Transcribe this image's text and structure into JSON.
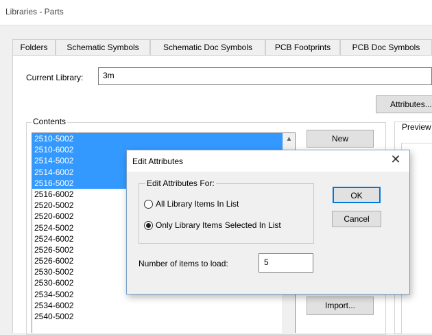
{
  "window": {
    "title": "Libraries - Parts"
  },
  "tabs": [
    {
      "label": "Folders",
      "active": false
    },
    {
      "label": "Schematic Symbols",
      "active": false
    },
    {
      "label": "Schematic Doc Symbols",
      "active": false
    },
    {
      "label": "PCB Footprints",
      "active": false
    },
    {
      "label": "PCB Doc Symbols",
      "active": false
    }
  ],
  "current_library": {
    "label": "Current Library:",
    "value": "3m"
  },
  "buttons": {
    "attributes": "Attributes...",
    "new": "New",
    "import": "Import..."
  },
  "contents": {
    "label": "Contents",
    "items": [
      {
        "text": "2510-5002",
        "selected": true
      },
      {
        "text": "2510-6002",
        "selected": true
      },
      {
        "text": "2514-5002",
        "selected": true
      },
      {
        "text": "2514-6002",
        "selected": true
      },
      {
        "text": "2516-5002",
        "selected": true
      },
      {
        "text": "2516-6002",
        "selected": false
      },
      {
        "text": "2520-5002",
        "selected": false
      },
      {
        "text": "2520-6002",
        "selected": false
      },
      {
        "text": "2524-5002",
        "selected": false
      },
      {
        "text": "2524-6002",
        "selected": false
      },
      {
        "text": "2526-5002",
        "selected": false
      },
      {
        "text": "2526-6002",
        "selected": false
      },
      {
        "text": "2530-5002",
        "selected": false
      },
      {
        "text": "2530-6002",
        "selected": false
      },
      {
        "text": "2534-5002",
        "selected": false
      },
      {
        "text": "2534-6002",
        "selected": false
      },
      {
        "text": "2540-5002",
        "selected": false
      }
    ]
  },
  "preview": {
    "label": "Preview"
  },
  "dialog": {
    "title": "Edit Attributes",
    "close": "✕",
    "group_label": "Edit Attributes For:",
    "options": [
      {
        "label": "All Library Items In List",
        "checked": false
      },
      {
        "label": "Only Library Items Selected In List",
        "checked": true
      }
    ],
    "ok": "OK",
    "cancel": "Cancel",
    "num_label": "Number of items to load:",
    "num_value": "5"
  },
  "colors": {
    "selection": "#3399ff",
    "ok_border": "#0078d7"
  }
}
